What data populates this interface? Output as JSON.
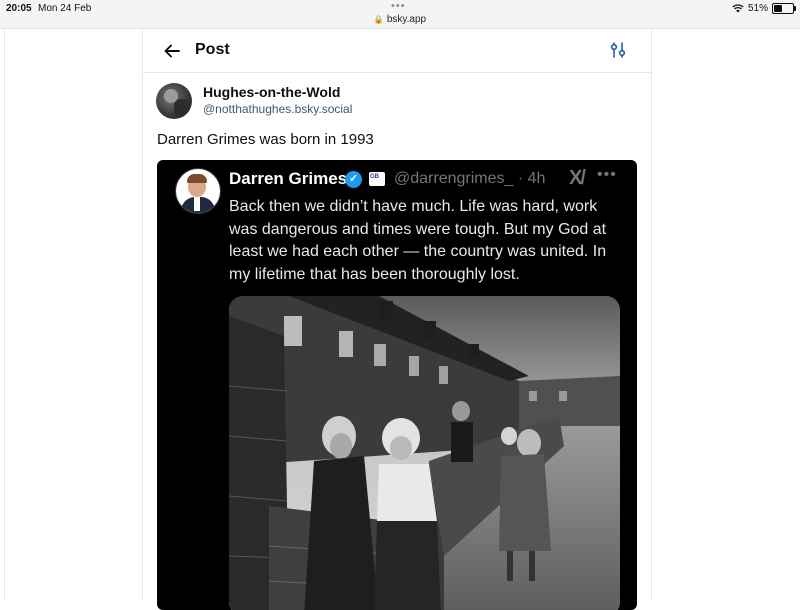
{
  "status_bar": {
    "time": "20:05",
    "date": "Mon 24 Feb",
    "url": "bsky.app",
    "battery": "51%",
    "battery_level": 0.51
  },
  "header": {
    "title": "Post"
  },
  "post": {
    "author_name": "Hughes-on-the-Wold",
    "author_handle": "@notthathughes.bsky.social",
    "text": "Darren Grimes was born in 1993"
  },
  "embedded_tweet": {
    "name": "Darren Grimes",
    "badge_text": "GB",
    "handle_time": "@darrengrimes_ · 4h",
    "text": "Back then we didn’t have much. Life was hard, work was dangerous and times were tough. But my God at least we had each other — the country was united. In my lifetime that has been thoroughly lost."
  },
  "colors": {
    "accent": "#1d9bf0",
    "border": "#e4e7eb",
    "handle": "#42576c"
  }
}
